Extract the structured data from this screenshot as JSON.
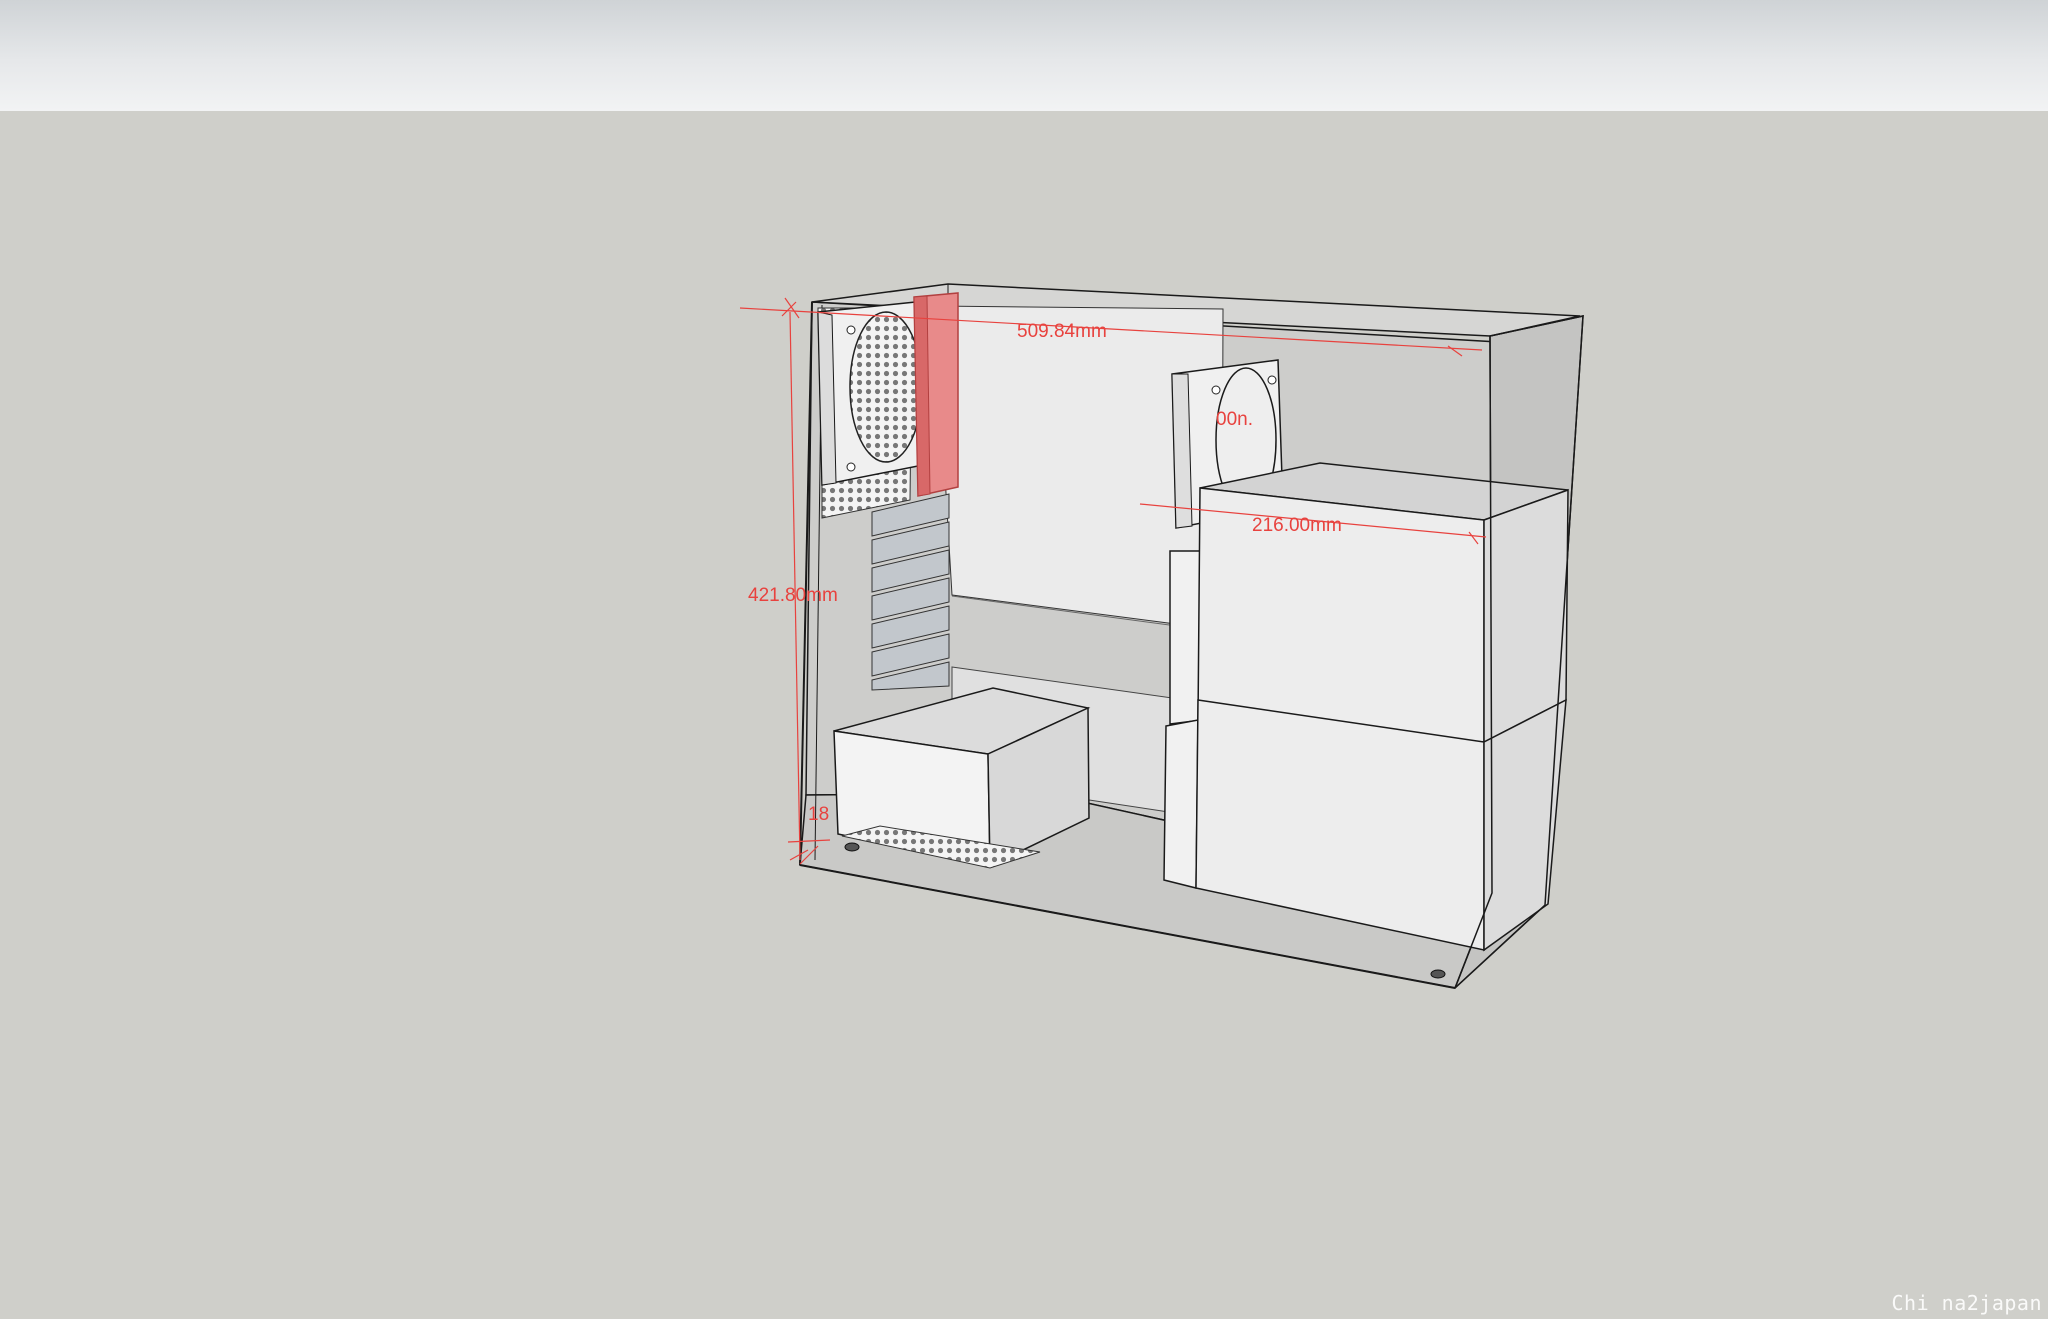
{
  "scene": {
    "dimensions": {
      "length": "509.84mm",
      "height": "421.80mm",
      "depth": "216.00mm",
      "fan_partial": "00n.",
      "bottom_partial": "18"
    },
    "colors": {
      "sky_top": "#cfd3d6",
      "ground": "#cfcfca",
      "dimension": "#e8423e",
      "highlight_part": "#e87e7e",
      "edge": "#1a1a1a"
    }
  },
  "watermark": "Chi na2japan"
}
